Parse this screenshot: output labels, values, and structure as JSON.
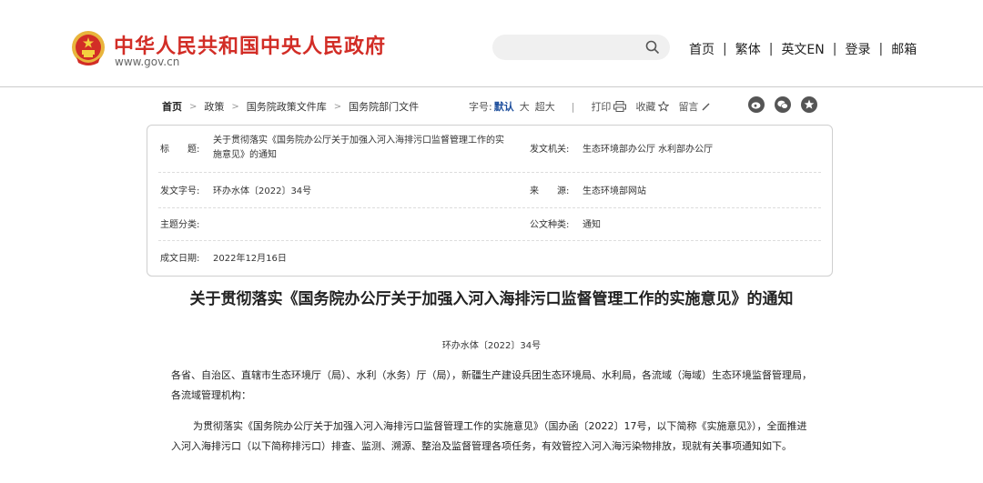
{
  "header": {
    "site_title": "中华人民共和国中央人民政府",
    "site_url": "www.gov.cn",
    "search_placeholder": "",
    "nav": [
      "首页",
      "繁体",
      "英文EN",
      "登录",
      "邮箱"
    ],
    "nav_sep": "|"
  },
  "breadcrumb": {
    "items": [
      "首页",
      "政策",
      "国务院政策文件库",
      "国务院部门文件"
    ],
    "arrow": ">"
  },
  "tools": {
    "font_label": "字号:",
    "sizes": [
      "默认",
      "大",
      "超大"
    ],
    "divider": "|",
    "print": "打印",
    "favorite": "收藏",
    "comment": "留言"
  },
  "info": {
    "title_label": "标　　题:",
    "title_value_line1": "关于贯彻落实《国务院办公厅关于加强入河入海排污口监督管理工作的实",
    "title_value_line2": "施意见》的通知",
    "issuer_label": "发文机关:",
    "issuer_value": "生态环境部办公厅 水利部办公厅",
    "docno_label": "发文字号:",
    "docno_value": "环办水体〔2022〕34号",
    "source_label": "来　　源:",
    "source_value": "生态环境部网站",
    "topic_label": "主题分类:",
    "topic_value": "",
    "type_label": "公文种类:",
    "type_value": "通知",
    "date_label": "成文日期:",
    "date_value": "2022年12月16日"
  },
  "article": {
    "title": "关于贯彻落实《国务院办公厅关于加强入河入海排污口监督管理工作的实施意见》的通知",
    "docno": "环办水体〔2022〕34号",
    "para1": "各省、自治区、直辖市生态环境厅（局）、水利（水务）厅（局），新疆生产建设兵团生态环境局、水利局，各流域（海域）生态环境监督管理局，各流域管理机构：",
    "para2": "为贯彻落实《国务院办公厅关于加强入河入海排污口监督管理工作的实施意见》（国办函〔2022〕17号，以下简称《实施意见》），全面推进入河入海排污口（以下简称排污口）排查、监测、溯源、整治及监督管理各项任务，有效管控入河入海污染物排放，现就有关事项通知如下。"
  },
  "colors": {
    "brand_red": "#d22d26",
    "accent_blue": "#1d4e9c"
  }
}
